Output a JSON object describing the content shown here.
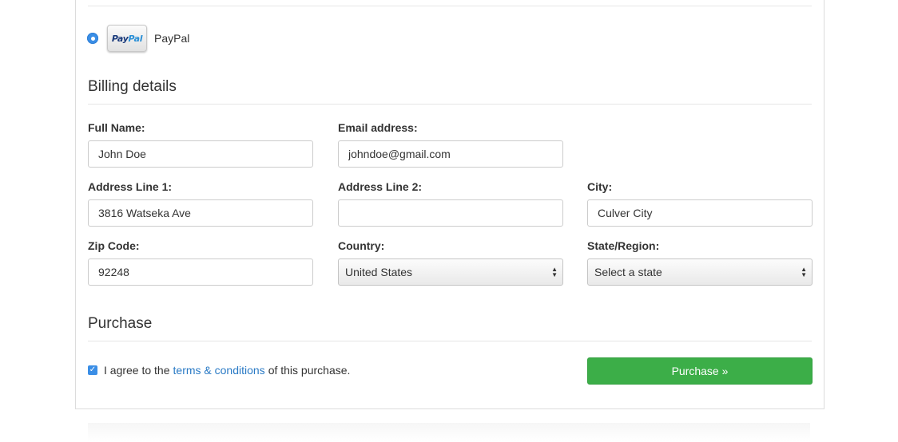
{
  "payment": {
    "selected": true,
    "logo_text_dark": "Pay",
    "logo_text_light": "Pal",
    "label": "PayPal"
  },
  "billing": {
    "title": "Billing details",
    "full_name": {
      "label": "Full Name:",
      "value": "John Doe"
    },
    "email": {
      "label": "Email address:",
      "value": "johndoe@gmail.com"
    },
    "address1": {
      "label": "Address Line 1:",
      "value": "3816 Watseka Ave"
    },
    "address2": {
      "label": "Address Line 2:",
      "value": ""
    },
    "city": {
      "label": "City:",
      "value": "Culver City"
    },
    "zip": {
      "label": "Zip Code:",
      "value": "92248"
    },
    "country": {
      "label": "Country:",
      "value": "United States"
    },
    "state": {
      "label": "State/Region:",
      "value": "Select a state"
    }
  },
  "purchase": {
    "title": "Purchase",
    "agree_checked": true,
    "agree_prefix": "I agree to the",
    "terms_link": "terms & conditions",
    "agree_suffix": "of this purchase.",
    "button_label": "Purchase »"
  },
  "colors": {
    "accent_blue": "#3a8ee6",
    "link_blue": "#2a7ac5",
    "button_green": "#3cae48"
  }
}
